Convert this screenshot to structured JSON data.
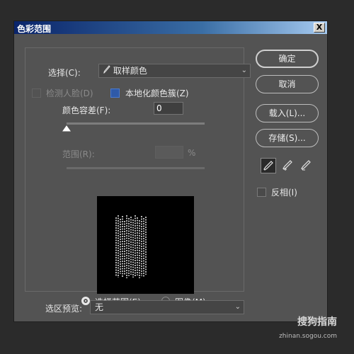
{
  "window": {
    "title": "色彩范围",
    "close_glyph": "X"
  },
  "select": {
    "label": "选择(C):",
    "value": "取样颜色",
    "icon": "eyedropper-icon"
  },
  "detect_faces": {
    "label": "检测人脸(D)",
    "checked": false,
    "enabled": false
  },
  "localized": {
    "label": "本地化颜色簇(Z)",
    "checked": true
  },
  "fuzziness": {
    "label": "颜色容差(F):",
    "value": "0",
    "slider_fraction": 0.0
  },
  "range": {
    "label": "范围(R):",
    "value": "",
    "unit": "%",
    "enabled": false
  },
  "view_mode": {
    "options": [
      {
        "label": "选择范围(E)",
        "selected": true
      },
      {
        "label": "图像(M)",
        "selected": false
      }
    ]
  },
  "preview_mode": {
    "label": "选区预览:",
    "value": "无"
  },
  "buttons": {
    "ok": "确定",
    "cancel": "取消",
    "load": "载入(L)...",
    "save": "存储(S)..."
  },
  "eyedroppers": [
    "eyedropper-icon",
    "eyedropper-plus-icon",
    "eyedropper-minus-icon"
  ],
  "invert": {
    "label": "反相(I)",
    "checked": false
  },
  "watermark": {
    "text": "搜狗指南",
    "sub": "zhinan.sogou.com"
  },
  "colors": {
    "dialog_bg": "#535353",
    "title_bar": "#0a246a",
    "accent": "#2f5aa8"
  }
}
